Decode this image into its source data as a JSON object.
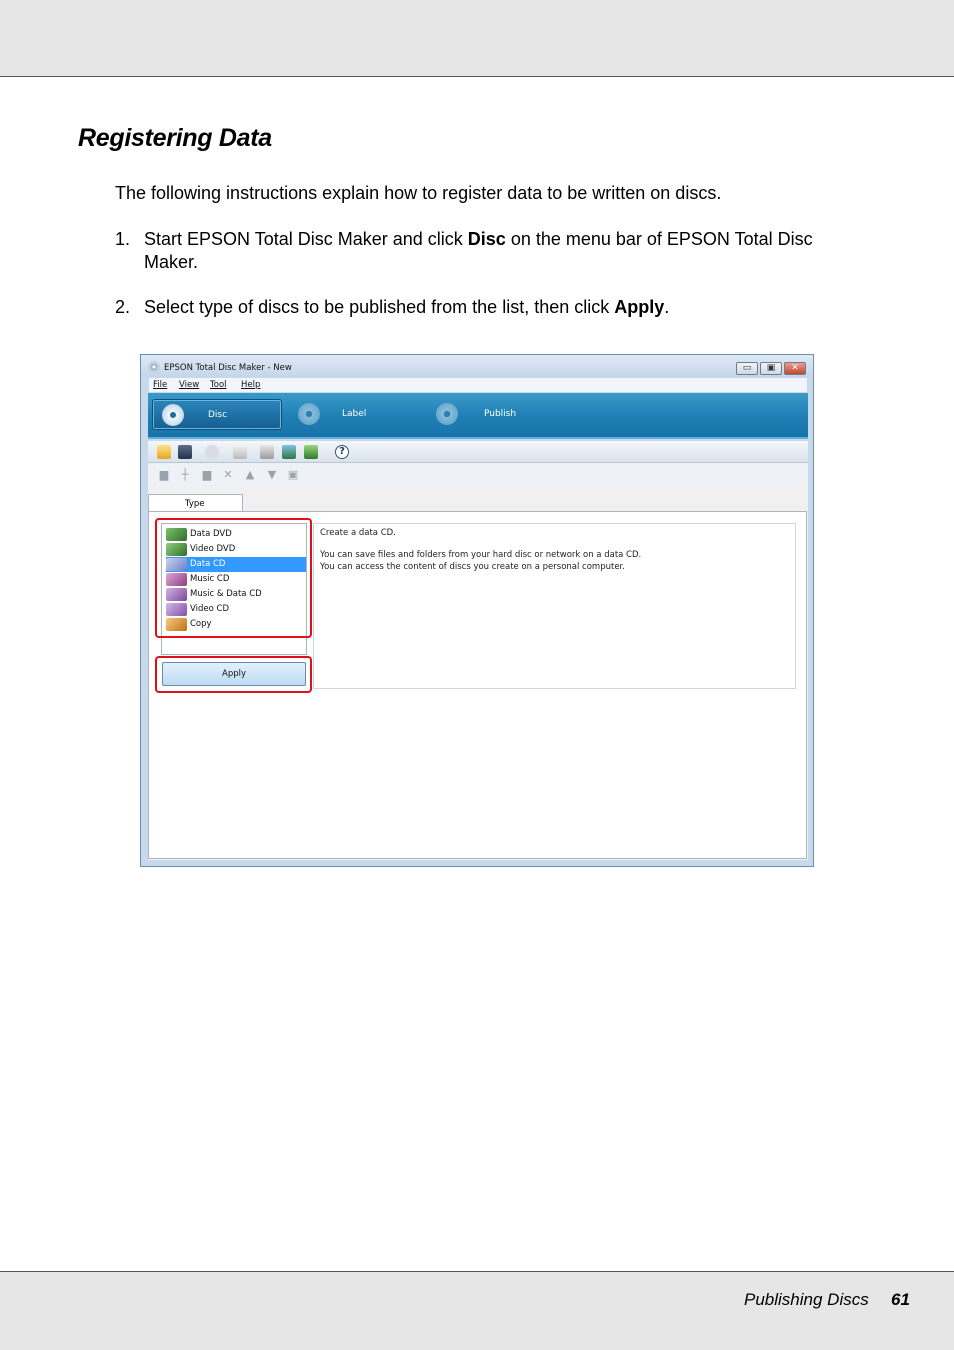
{
  "document": {
    "section_title": "Registering Data",
    "intro": "The following instructions explain how to register data to be written on discs.",
    "steps": [
      {
        "number": "1.",
        "line1_before": "Start EPSON Total Disc Maker and click ",
        "line1_bold": "Disc",
        "line1_after": " on the menu bar of EPSON Total Disc",
        "line2": "Maker."
      },
      {
        "number": "2.",
        "before": "Select type of discs to be published from the list, then click ",
        "bold": "Apply",
        "after": "."
      }
    ],
    "footer": {
      "title": "Publishing Discs",
      "page": "61"
    }
  },
  "app_window": {
    "title": "EPSON Total Disc Maker - New",
    "controls": {
      "minimize": "▭",
      "restore": "▣",
      "close": "✕"
    },
    "menu": [
      "File",
      "View",
      "Tool",
      "Help"
    ],
    "nav": [
      {
        "label": "Disc",
        "icon": "disc-icon",
        "active": true
      },
      {
        "label": "Label",
        "icon": "label-icon",
        "active": false
      },
      {
        "label": "Publish",
        "icon": "publish-icon",
        "active": false
      }
    ],
    "tab_label": "Type",
    "disc_types": [
      {
        "label": "Data DVD",
        "icon": "data-dvd-icon",
        "color": "#3d8a3a"
      },
      {
        "label": "Video DVD",
        "icon": "video-dvd-icon",
        "color": "#4b9c43"
      },
      {
        "label": "Data CD",
        "icon": "data-cd-icon",
        "color": "#7b8fd1",
        "selected": true
      },
      {
        "label": "Music CD",
        "icon": "music-cd-icon",
        "color": "#a0508e"
      },
      {
        "label": "Music & Data CD",
        "icon": "music-data-cd-icon",
        "color": "#8f5aa6"
      },
      {
        "label": "Video CD",
        "icon": "video-cd-icon",
        "color": "#9a62b0"
      },
      {
        "label": "Copy",
        "icon": "copy-icon",
        "color": "#d08a2a"
      }
    ],
    "apply_label": "Apply",
    "description": {
      "line1": "Create a data CD.",
      "line2": "You can save files and folders from your hard disc or network on a data CD.",
      "line3": "You can access the content of discs you create on a personal computer."
    }
  }
}
